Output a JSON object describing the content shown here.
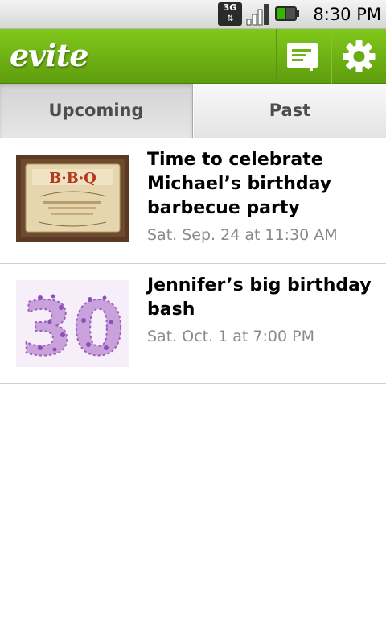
{
  "status_bar": {
    "network": "3G",
    "network_arrows": "⇅",
    "signal_icon": "signal-bars-icon",
    "battery_icon": "battery-icon",
    "battery_color": "#35b400",
    "time": "8:30 PM"
  },
  "header": {
    "logo": "evite",
    "background_color": "#6fb315",
    "compose_icon": "new-invitation-icon",
    "settings_icon": "gear-icon"
  },
  "tabs": [
    {
      "label": "Upcoming",
      "selected": true
    },
    {
      "label": "Past",
      "selected": false
    }
  ],
  "events": [
    {
      "title": "Time to celebrate Michael’s birthday barbecue party",
      "date": "Sat. Sep. 24 at 11:30 AM",
      "thumbnail_text": "B·B·Q",
      "thumbnail_icon": "bbq-invitation-thumbnail"
    },
    {
      "title": "Jennifer’s big birthday bash",
      "date": "Sat. Oct. 1 at 7:00 PM",
      "thumbnail_text": "30",
      "thumbnail_icon": "floral-30-thumbnail"
    }
  ]
}
